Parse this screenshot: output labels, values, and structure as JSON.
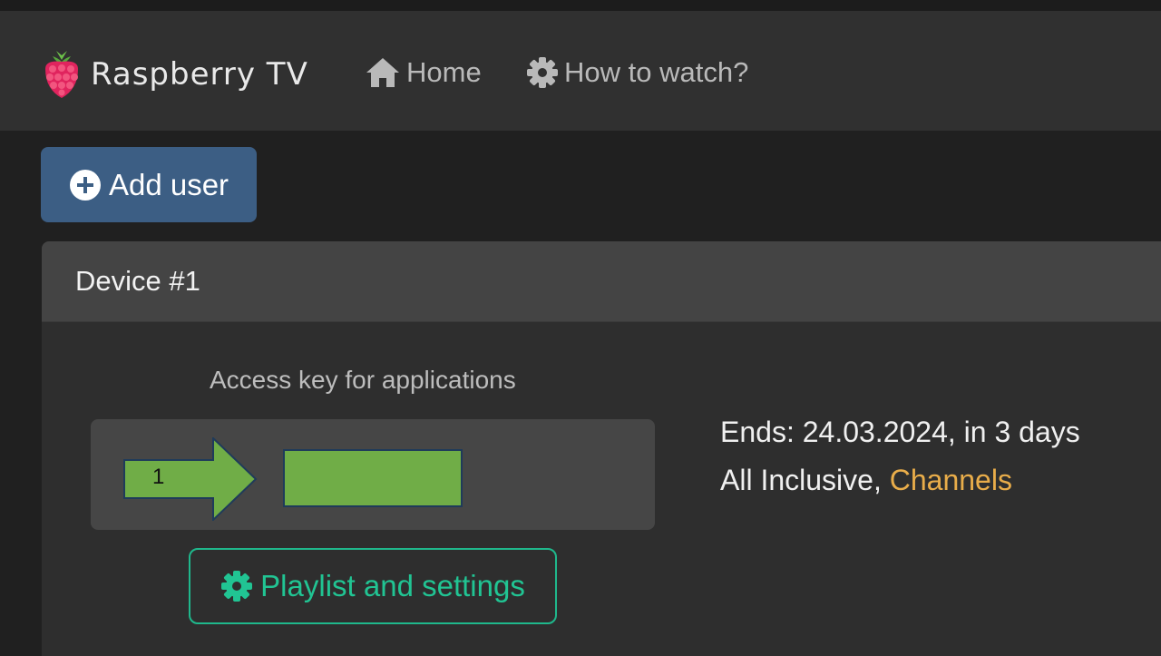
{
  "brand": {
    "name": "Raspberry TV",
    "logo_icon": "raspberry-logo-icon",
    "logo_color": "#e0245e"
  },
  "nav": {
    "items": [
      {
        "label": "Home",
        "icon": "home-icon"
      },
      {
        "label": "How to watch?",
        "icon": "gear-icon"
      }
    ]
  },
  "toolbar": {
    "add_user_label": "Add user",
    "add_user_icon": "plus-circle-icon"
  },
  "device": {
    "title": "Device #1",
    "access_key_label": "Access key for applications",
    "annotation_step": "1",
    "ends_text": "Ends: 24.03.2024, in 3 days",
    "plan_text": "All Inclusive, ",
    "channels_label": "Channels",
    "playlist_button_label": "Playlist and settings"
  },
  "colors": {
    "accent_blue": "#3c5e84",
    "accent_green": "#21c493",
    "link_orange": "#e9ad4a",
    "annotation_green": "#70ad47"
  }
}
